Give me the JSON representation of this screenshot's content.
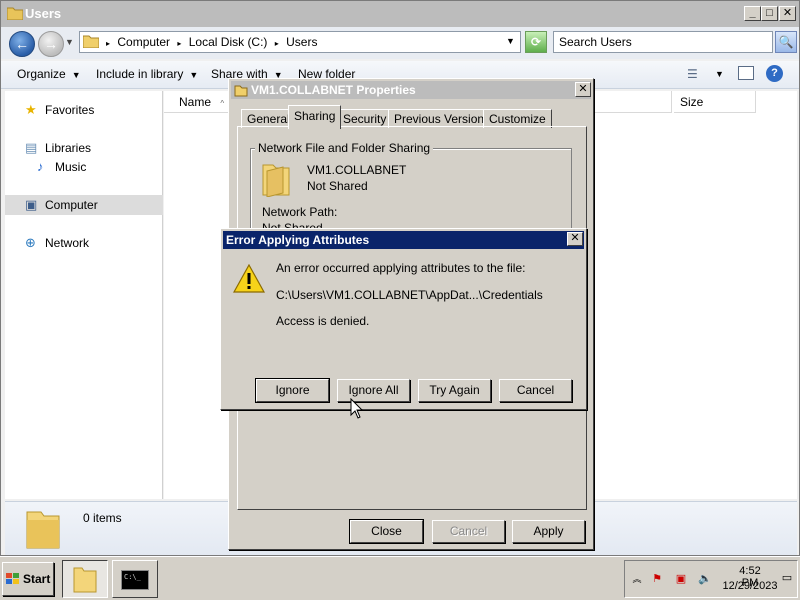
{
  "explorer": {
    "title": "Users",
    "breadcrumb": [
      "Computer",
      "Local Disk (C:)",
      "Users"
    ],
    "search_placeholder": "Search Users",
    "toolbar": {
      "organize": "Organize",
      "include_in_library": "Include in library",
      "share_with": "Share with",
      "new_folder": "New folder"
    },
    "nav": {
      "favorites": "Favorites",
      "libraries": "Libraries",
      "music": "Music",
      "computer": "Computer",
      "network": "Network"
    },
    "columns": {
      "name": "Name",
      "size": "Size"
    },
    "details": {
      "items": "0 items"
    }
  },
  "properties": {
    "title": "VM1.COLLABNET Properties",
    "tabs": [
      "General",
      "Sharing",
      "Security",
      "Previous Versions",
      "Customize"
    ],
    "active_tab": "Sharing",
    "group_label": "Network File and Folder Sharing",
    "share_name": "VM1.COLLABNET",
    "share_status": "Not Shared",
    "network_path_label": "Network Path:",
    "network_path_value": "Not Shared",
    "buttons": {
      "close": "Close",
      "cancel": "Cancel",
      "apply": "Apply"
    }
  },
  "error_dialog": {
    "title": "Error Applying Attributes",
    "message": "An error occurred applying attributes to the file:",
    "path": "C:\\Users\\VM1.COLLABNET\\AppDat...\\Credentials",
    "detail": "Access is denied.",
    "buttons": {
      "ignore": "Ignore",
      "ignore_all": "Ignore All",
      "try_again": "Try Again",
      "cancel": "Cancel"
    }
  },
  "taskbar": {
    "start_label": "Start",
    "clock_time": "4:52 PM",
    "clock_date": "12/29/2023",
    "cmd_icon_text": "C:\\_"
  },
  "colors": {
    "active_title": "#0a246a",
    "inactive_title": "#bcbcbc",
    "dialog_face": "#d4d0c8"
  }
}
